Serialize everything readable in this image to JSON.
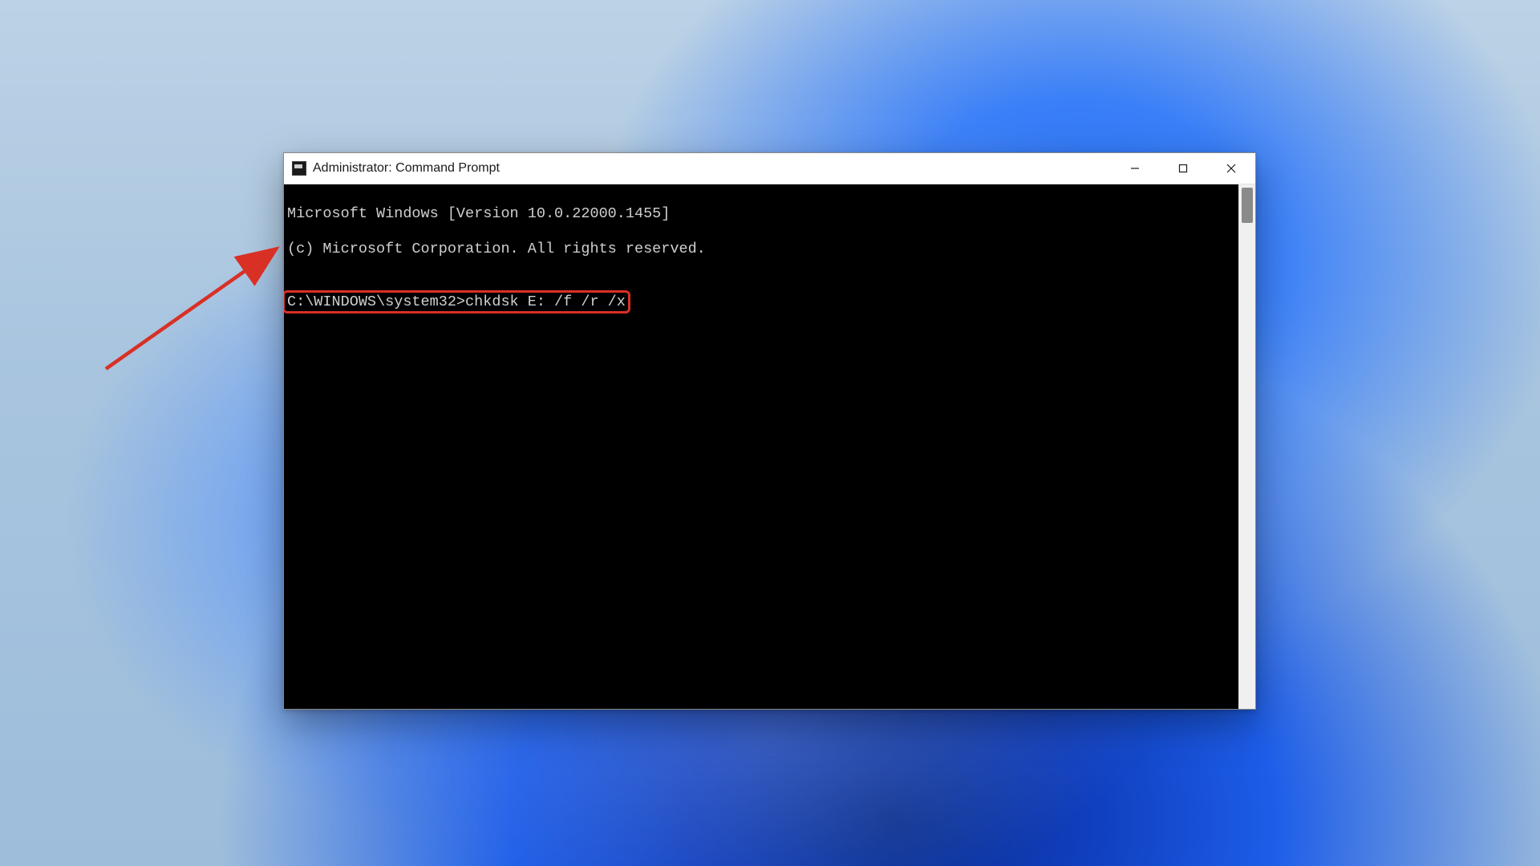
{
  "window": {
    "title": "Administrator: Command Prompt"
  },
  "terminal": {
    "line1": "Microsoft Windows [Version 10.0.22000.1455]",
    "line2": "(c) Microsoft Corporation. All rights reserved.",
    "blank": "",
    "prompt_full": "C:\\WINDOWS\\system32>chkdsk E: /f /r /x",
    "prompt_path": "C:\\WINDOWS\\system32>",
    "command": "chkdsk E: /f /r /x"
  },
  "annotation": {
    "highlight_color": "#d93025",
    "arrow_color": "#d93025"
  }
}
